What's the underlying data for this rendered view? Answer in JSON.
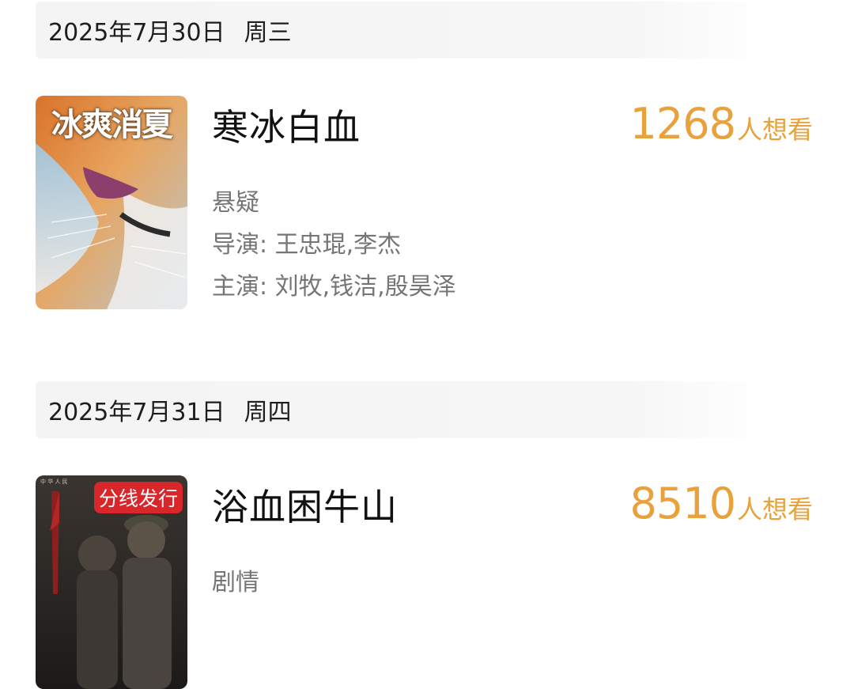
{
  "sections": [
    {
      "date": "2025年7月30日",
      "weekday": "周三",
      "movie": {
        "title": "寒冰白血",
        "want_count": "1268",
        "want_suffix": "人想看",
        "genre": "悬疑",
        "director": "导演: 王忠琨,李杰",
        "cast": "主演: 刘牧,钱洁,殷昊泽",
        "poster_text": "冰爽消夏"
      }
    },
    {
      "date": "2025年7月31日",
      "weekday": "周四",
      "movie": {
        "title": "浴血困牛山",
        "want_count": "8510",
        "want_suffix": "人想看",
        "genre": "剧情",
        "poster_badge": "分线发行"
      }
    }
  ],
  "colors": {
    "accent": "#e9a23b",
    "date_bar_bg": "#f4f4f4",
    "meta_text": "#757575",
    "badge_red": "#d8262a"
  }
}
